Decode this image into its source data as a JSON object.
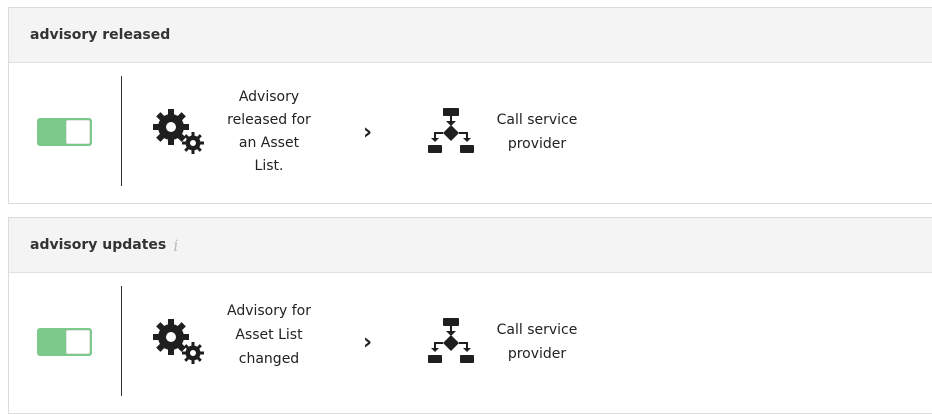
{
  "rules": [
    {
      "title": "advisory released",
      "has_info": false,
      "enabled": true,
      "trigger_icon": "gears-icon",
      "trigger_lines": [
        "Advisory",
        "released for",
        "an Asset",
        "List."
      ],
      "arrow_icon": "chevron-right-icon",
      "action_icon": "flowchart-icon",
      "action_lines": [
        "Call service",
        "provider"
      ]
    },
    {
      "title": "advisory updates",
      "has_info": true,
      "info_icon_glyph": "i",
      "enabled": true,
      "trigger_icon": "gears-icon",
      "trigger_lines": [
        "Advisory for",
        "Asset List",
        "changed"
      ],
      "arrow_icon": "chevron-right-icon",
      "action_icon": "flowchart-icon",
      "action_lines": [
        "Call service",
        "provider"
      ]
    }
  ],
  "colors": {
    "toggle_on": "#7cc98b",
    "header_bg": "#f4f4f4",
    "icon_dark": "#1f1f1f"
  }
}
